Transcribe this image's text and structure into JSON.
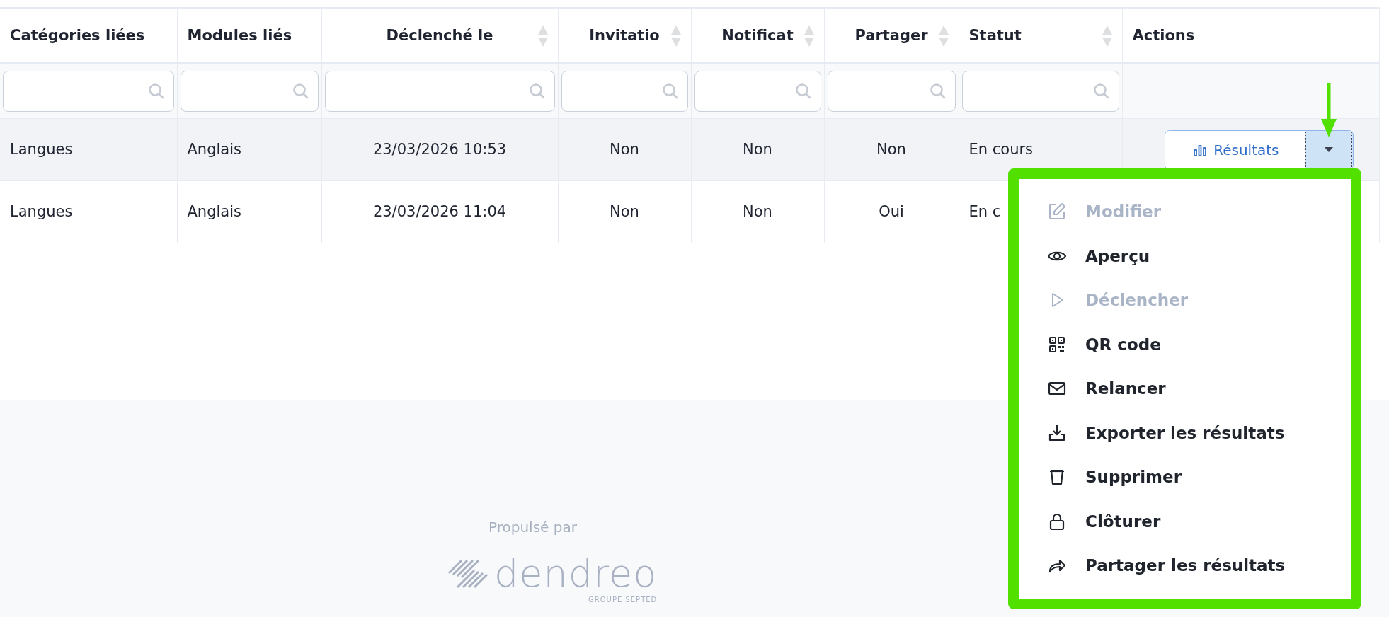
{
  "table": {
    "columns": [
      {
        "label": "Catégories liées",
        "sortable": false,
        "filter": true
      },
      {
        "label": "Modules liés",
        "sortable": false,
        "filter": true
      },
      {
        "label": "Déclenché le",
        "sortable": true,
        "filter": true
      },
      {
        "label": "Invitatio",
        "sortable": true,
        "filter": true
      },
      {
        "label": "Notificat",
        "sortable": true,
        "filter": true
      },
      {
        "label": "Partager",
        "sortable": true,
        "filter": true
      },
      {
        "label": "Statut",
        "sortable": true,
        "filter": true
      },
      {
        "label": "Actions",
        "sortable": false,
        "filter": false
      }
    ],
    "rows": [
      {
        "hovered": true,
        "cells": [
          "Langues",
          "Anglais",
          "23/03/2026 10:53",
          "Non",
          "Non",
          "Non",
          "En cours"
        ],
        "action": {
          "label": "Résultats"
        }
      },
      {
        "hovered": false,
        "cells": [
          "Langues",
          "Anglais",
          "23/03/2026 11:04",
          "Non",
          "Non",
          "Oui",
          "En c"
        ]
      }
    ]
  },
  "menu": {
    "items": [
      {
        "label": "Modifier",
        "disabled": true
      },
      {
        "label": "Aperçu",
        "disabled": false
      },
      {
        "label": "Déclencher",
        "disabled": true
      },
      {
        "label": "QR code",
        "disabled": false
      },
      {
        "label": "Relancer",
        "disabled": false
      },
      {
        "label": "Exporter les résultats",
        "disabled": false
      },
      {
        "label": "Supprimer",
        "disabled": false
      },
      {
        "label": "Clôturer",
        "disabled": false
      },
      {
        "label": "Partager les résultats",
        "disabled": false
      }
    ]
  },
  "footer": {
    "powered_by": "Propulsé par",
    "logo": "dendreo",
    "tagline": "GROUPE SEPTED"
  }
}
